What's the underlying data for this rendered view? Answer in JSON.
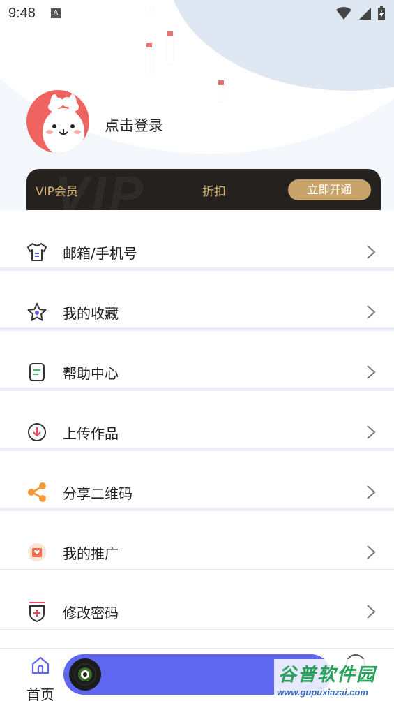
{
  "status_bar": {
    "time": "9:48",
    "notification_glyph": "A",
    "icons": [
      "wifi-icon",
      "signal-icon",
      "battery-charging-icon"
    ]
  },
  "profile": {
    "avatar_icon": "alpaca-avatar-icon",
    "login_label": "点击登录"
  },
  "vip": {
    "label": "VIP会员",
    "watermark": "VIP",
    "discount_label": "折扣",
    "open_button": "立即开通",
    "accent_color": "#d9b46e",
    "button_color": "#c8a36a"
  },
  "menu": {
    "items": [
      {
        "label": "邮箱/手机号",
        "icon": "tshirt-icon"
      },
      {
        "label": "我的收藏",
        "icon": "star-icon"
      },
      {
        "label": "帮助中心",
        "icon": "document-icon"
      },
      {
        "label": "上传作品",
        "icon": "download-circle-icon"
      },
      {
        "label": "分享二维码",
        "icon": "share-icon"
      },
      {
        "label": "我的推广",
        "icon": "heart-envelope-icon"
      },
      {
        "label": "修改密码",
        "icon": "shield-plus-icon"
      }
    ],
    "chevron_icon": "chevron-right-icon"
  },
  "bottom_nav": {
    "home_label": "首页",
    "home_icon": "home-icon",
    "player_icon": "disc-icon",
    "player_color": "#5f66f0",
    "me_icon": "user-circle-icon"
  },
  "watermark_logo": {
    "title": "谷普软件园",
    "url": "www.gupuxiazai.com"
  }
}
